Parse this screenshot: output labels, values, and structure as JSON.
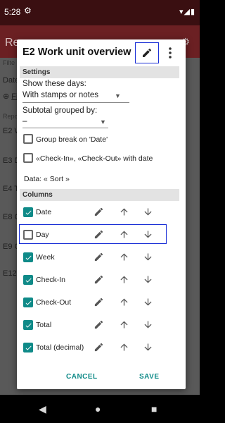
{
  "status": {
    "time": "5:28"
  },
  "app": {
    "title_partial": "Re",
    "filter_partial": "Filte",
    "date_partial": "Date",
    "fi_partial": "Fi",
    "repo_partial": "Repo",
    "list": [
      "E2 W",
      "E3 D",
      "E4 T",
      "E8 C",
      "E9 C",
      "E12"
    ]
  },
  "dialog": {
    "title": "E2 Work unit overview",
    "settings_header": "Settings",
    "show_days_label": "Show these days:",
    "show_days_value": "With stamps or notes",
    "subtotal_label": "Subtotal grouped by:",
    "subtotal_value": "–",
    "group_break_label": "Group break on 'Date'",
    "checkin_checkout_label": "«Check-In», «Check-Out» with date",
    "data_line": "Data: « Sort »",
    "columns_header": "Columns",
    "columns": [
      {
        "label": "Date",
        "checked": true
      },
      {
        "label": "Day",
        "checked": false
      },
      {
        "label": "Week",
        "checked": true
      },
      {
        "label": "Check-In",
        "checked": true
      },
      {
        "label": "Check-Out",
        "checked": true
      },
      {
        "label": "Total",
        "checked": true
      },
      {
        "label": "Total (decimal)",
        "checked": true
      }
    ],
    "cancel_label": "CANCEL",
    "save_label": "SAVE"
  },
  "colors": {
    "accent": "#0f8a88",
    "highlight": "#1a2fd6",
    "appbar": "#6b2023"
  }
}
